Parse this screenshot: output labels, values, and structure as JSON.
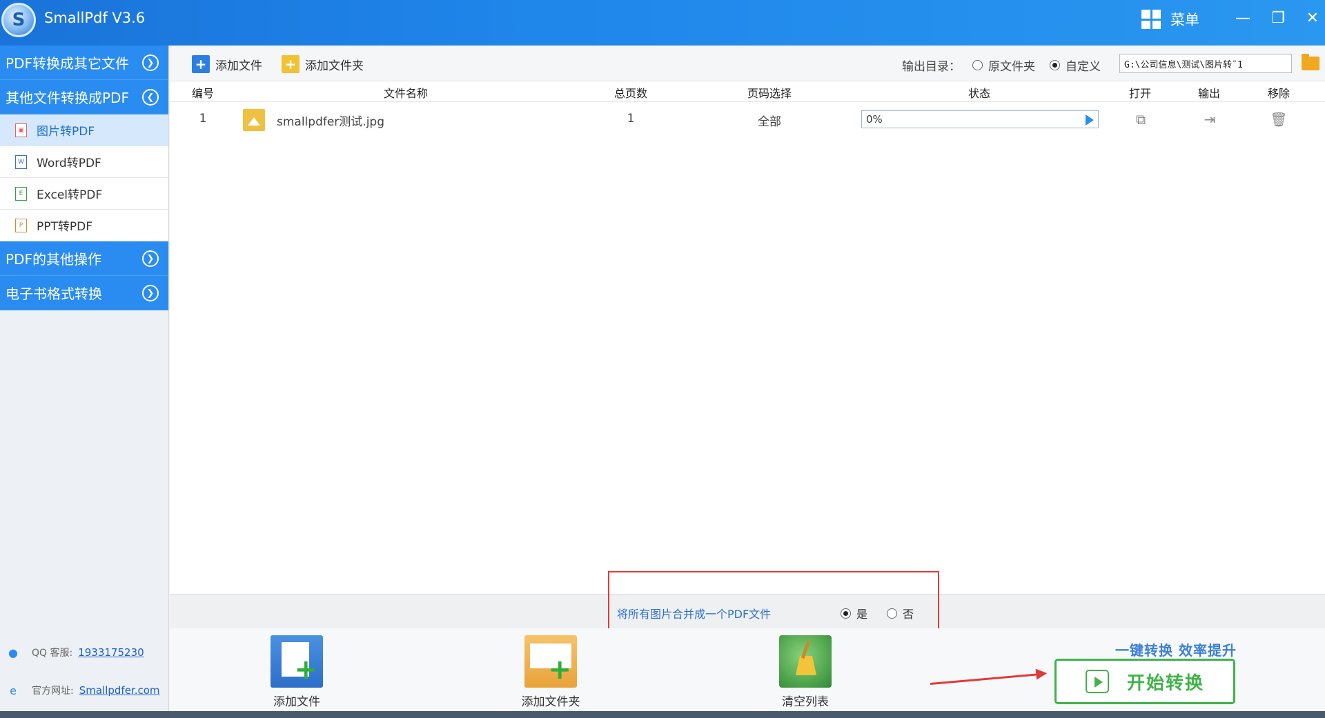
{
  "app": {
    "title": "SmallPdf V3.6",
    "logo_letter": "S",
    "menu_label": "菜单"
  },
  "window_controls": {
    "minimize": "—",
    "restore": "❐",
    "close": "✕"
  },
  "sidebar": {
    "categories": [
      {
        "label": "PDF转换成其它文件"
      },
      {
        "label": "其他文件转换成PDF"
      },
      {
        "label": "PDF的其他操作"
      },
      {
        "label": "电子书格式转换"
      }
    ],
    "sub_items": [
      {
        "label": "图片转PDF",
        "icon": "image-file-icon"
      },
      {
        "label": "Word转PDF",
        "icon": "word-file-icon"
      },
      {
        "label": "Excel转PDF",
        "icon": "excel-file-icon"
      },
      {
        "label": "PPT转PDF",
        "icon": "ppt-file-icon"
      }
    ],
    "footer": {
      "qq_label": "QQ 客服:",
      "qq_number": "1933175230",
      "site_label": "官方网址:",
      "site_url": "Smallpdfer.com"
    }
  },
  "toolbar": {
    "add_file": "添加文件",
    "add_folder": "添加文件夹",
    "output_label": "输出目录：",
    "option_original": "原文件夹",
    "option_custom": "自定义",
    "output_path": "G:\\公司信息\\测试\\图片转˜1"
  },
  "table": {
    "headers": [
      "编号",
      "文件名称",
      "总页数",
      "页码选择",
      "状态",
      "打开",
      "输出",
      "移除"
    ],
    "rows": [
      {
        "index": "1",
        "name": "smallpdfer测试.jpg",
        "pages": "1",
        "range": "全部",
        "progress_text": "0%",
        "progress": 0
      }
    ]
  },
  "merge": {
    "label": "将所有图片合并成一个PDF文件",
    "yes": "是",
    "no": "否",
    "selected": "yes"
  },
  "bottom": {
    "add_file": "添加文件",
    "add_folder": "添加文件夹",
    "clear_list": "清空列表",
    "slogan": "一键转换  效率提升",
    "start": "开始转换"
  },
  "colors": {
    "accent": "#2a8cf0",
    "start": "#3fb34a",
    "highlight": "#e23a3a"
  }
}
